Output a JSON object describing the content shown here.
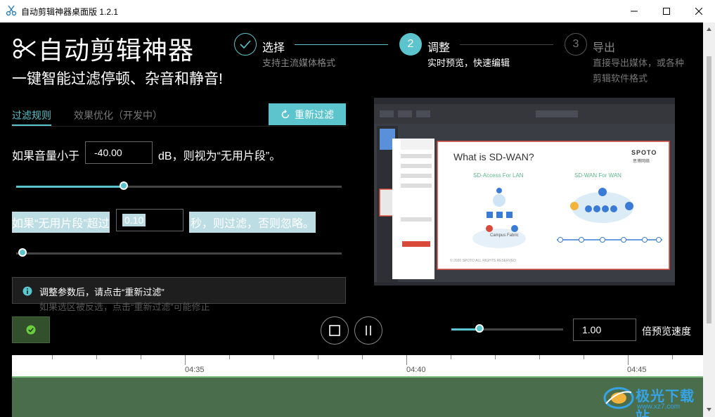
{
  "window": {
    "title": "自动剪辑神器桌面版 1.2.1"
  },
  "header": {
    "logo_text": "自动剪辑神器",
    "slogan": "一键智能过滤停顿、杂音和静音!"
  },
  "steps": [
    {
      "number": "✓",
      "title": "选择",
      "desc": "支持主流媒体格式",
      "state": "done"
    },
    {
      "number": "2",
      "title": "调整",
      "desc": "实时预览，快速编辑",
      "state": "active"
    },
    {
      "number": "3",
      "title": "导出",
      "desc_line1": "直接导出媒体，或各种",
      "desc_line2": "剪辑软件格式",
      "state": "pending"
    }
  ],
  "tabs": [
    {
      "label": "过滤规则",
      "active": true
    },
    {
      "label": "效果优化（开发中）",
      "active": false
    }
  ],
  "refilter_button": {
    "label": "重新过滤"
  },
  "rule_volume": {
    "prefix": "如果音量小于",
    "value": "-40.00",
    "suffix": "dB，则视为“无用片段”。",
    "slider_fraction": 0.33
  },
  "rule_duration": {
    "prefix": "如果“无用片段”超过",
    "value": "0.10",
    "suffix": "秒，则过滤，否则忽略。",
    "slider_fraction": 0.02
  },
  "info": {
    "text": "调整参数后，请点击“重新过滤”",
    "faded_text": "如果选区被反选，点击“重新过滤”可能修正"
  },
  "playback": {
    "speed_value": "1.00",
    "speed_label": "倍预览速度",
    "speed_slider_fraction": 0.25
  },
  "timeline": {
    "labels": [
      "04:35",
      "04:40",
      "04:45"
    ]
  },
  "preview": {
    "slide_title": "What is SD-WAN?",
    "brand": "SPOTO",
    "brand_sub": "思博网络",
    "left_diagram_title": "SD-Access For LAN",
    "right_diagram_title": "SD-WAN For WAN",
    "campus_label": "Campus Fabric",
    "footer": "© 2020 SPOTO ALL RIGHTS RESERVED"
  },
  "watermark": {
    "text": "极光下载站",
    "sub": "www.xz7.com"
  },
  "colors": {
    "accent": "#5bc4cc",
    "background": "#000000",
    "wave": "#4a6e4b",
    "info_icon": "#5bc4cc"
  }
}
